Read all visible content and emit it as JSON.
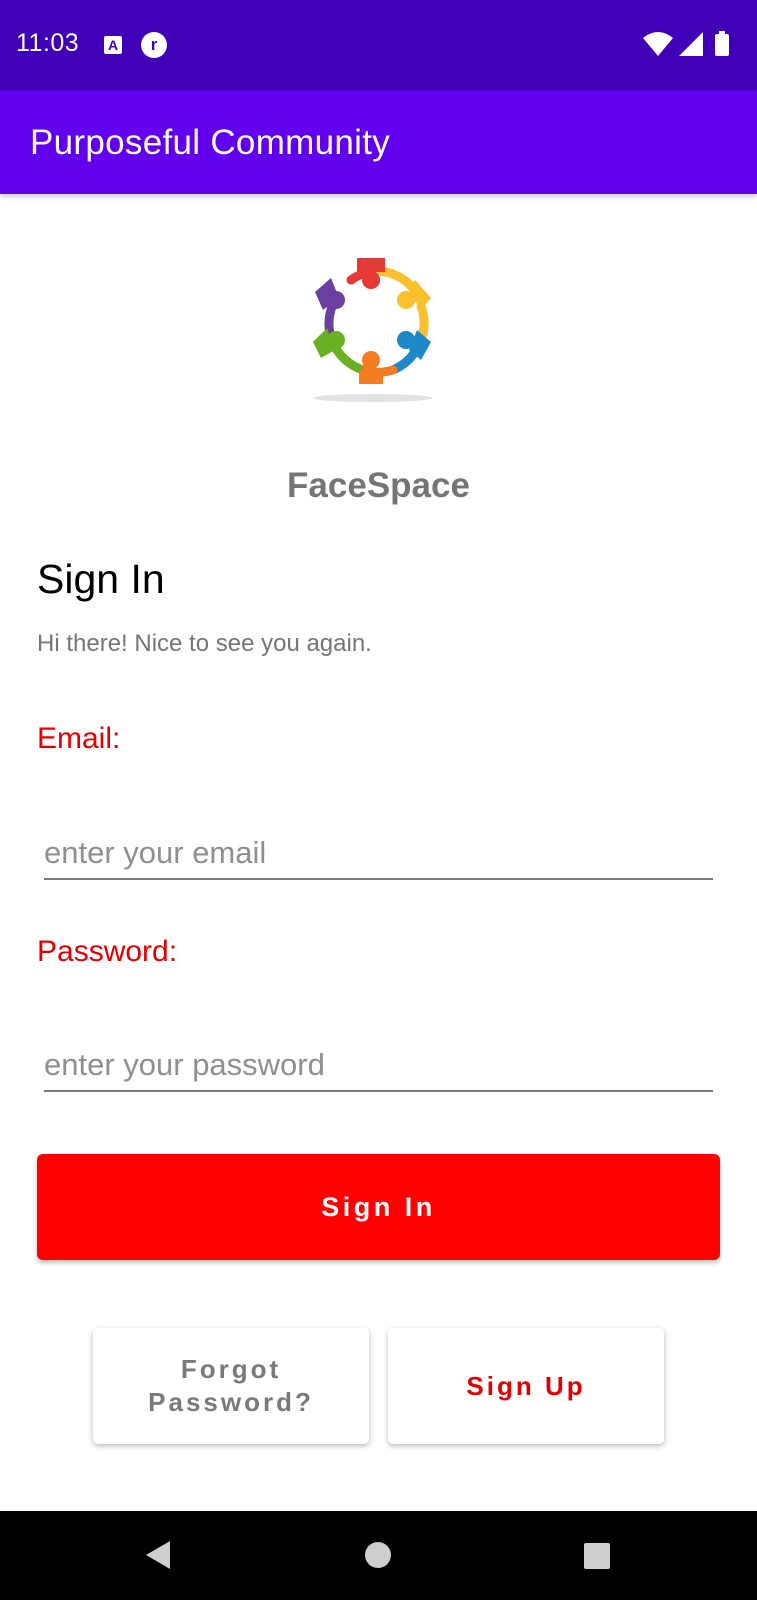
{
  "status_bar": {
    "time": "11:03",
    "left_icons": [
      "a-letter-icon",
      "r-circle-icon"
    ],
    "right_icons": [
      "wifi-icon",
      "cell-signal-icon",
      "battery-icon"
    ]
  },
  "app_bar": {
    "title": "Purposeful Community"
  },
  "brand": {
    "name": "FaceSpace",
    "logo": "community-circle-logo"
  },
  "sign_in": {
    "heading": "Sign In",
    "subheading": "Hi there! Nice to see you again.",
    "email_label": "Email:",
    "email_placeholder": "enter your email",
    "email_value": "",
    "password_label": "Password:",
    "password_placeholder": "enter your password",
    "password_value": "",
    "button_label": "Sign In"
  },
  "secondary": {
    "forgot_line1": "Forgot",
    "forgot_line2": "Password?",
    "signup_label": "Sign Up"
  },
  "nav_bar": {
    "icons": [
      "back-icon",
      "home-icon",
      "recents-icon"
    ]
  },
  "colors": {
    "status_bar": "#3f00b7",
    "app_bar": "#6200ee",
    "accent_red": "#ff0000",
    "label_red": "#e00000",
    "muted_text": "#757575"
  }
}
